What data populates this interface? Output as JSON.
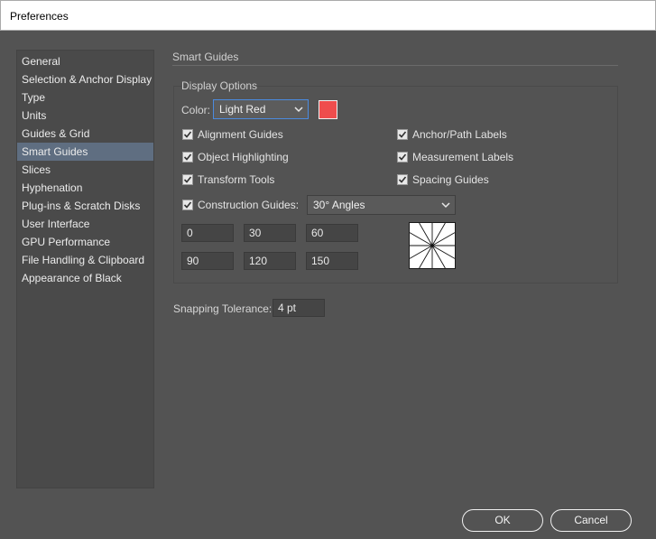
{
  "window": {
    "title": "Preferences"
  },
  "sidebar": {
    "items": [
      {
        "label": "General"
      },
      {
        "label": "Selection & Anchor Display"
      },
      {
        "label": "Type"
      },
      {
        "label": "Units"
      },
      {
        "label": "Guides & Grid"
      },
      {
        "label": "Smart Guides",
        "selected": true
      },
      {
        "label": "Slices"
      },
      {
        "label": "Hyphenation"
      },
      {
        "label": "Plug-ins & Scratch Disks"
      },
      {
        "label": "User Interface"
      },
      {
        "label": "GPU Performance"
      },
      {
        "label": "File Handling & Clipboard"
      },
      {
        "label": "Appearance of Black"
      }
    ]
  },
  "panel": {
    "title": "Smart Guides",
    "display_options": {
      "label": "Display Options",
      "color_label": "Color:",
      "color_value": "Light Red",
      "swatch_color": "#ef4d4d",
      "checks": {
        "alignment_guides": {
          "label": "Alignment Guides",
          "checked": true
        },
        "anchor_path_labels": {
          "label": "Anchor/Path Labels",
          "checked": true
        },
        "object_highlighting": {
          "label": "Object Highlighting",
          "checked": true
        },
        "measurement_labels": {
          "label": "Measurement Labels",
          "checked": true
        },
        "transform_tools": {
          "label": "Transform Tools",
          "checked": true
        },
        "spacing_guides": {
          "label": "Spacing Guides",
          "checked": true
        },
        "construction_guides": {
          "label": "Construction Guides:",
          "checked": true
        }
      },
      "construction_value": "30° Angles",
      "angles": [
        "0",
        "30",
        "60",
        "90",
        "120",
        "150"
      ]
    },
    "snapping": {
      "label": "Snapping Tolerance:",
      "value": "4 pt"
    }
  },
  "buttons": {
    "ok": "OK",
    "cancel": "Cancel"
  }
}
